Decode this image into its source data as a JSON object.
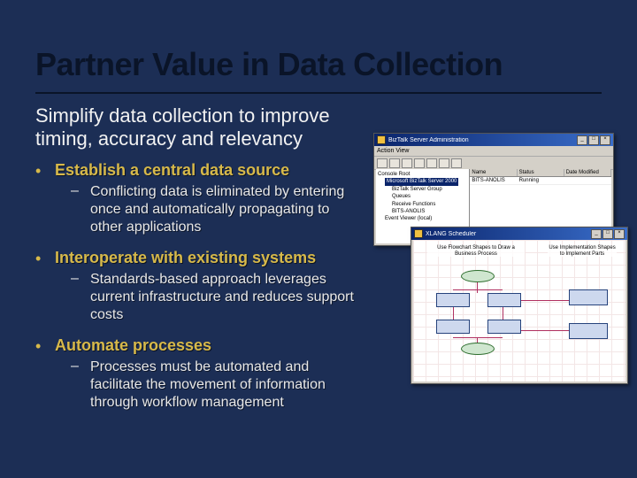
{
  "title": "Partner Value in Data Collection",
  "subtitle": "Simplify data collection to improve timing, accuracy and relevancy",
  "bullets": [
    {
      "heading": "Establish a central data source",
      "subs": [
        "Conflicting data is eliminated by entering once and automatically propagating to other applications"
      ]
    },
    {
      "heading": "Interoperate with existing systems",
      "subs": [
        "Standards-based approach leverages current infrastructure and reduces support costs"
      ]
    },
    {
      "heading": "Automate processes",
      "subs": [
        "Processes must be automated and facilitate the movement of information through workflow management"
      ]
    }
  ],
  "win1": {
    "title": "BizTalk Server Administration",
    "menu": "Action  View",
    "tree": {
      "root": "Console Root",
      "server": "Microsoft BizTalk Server 2000",
      "group": "BizTalk Server Group",
      "n1": "Queues",
      "n2": "Receive Functions",
      "n3": "BITS-ANOLIS",
      "leaf": "Event Viewer (local)"
    },
    "cols": {
      "c1": "Name",
      "c2": "Status",
      "c3": "Date Modified"
    },
    "row": {
      "c1": "BITS-ANOLIS",
      "c2": "Running",
      "c3": ""
    }
  },
  "win2": {
    "title": "XLANG Scheduler",
    "label_left": "Use Flowchart Shapes to Draw a Business Process",
    "label_right": "Use Implementation Shapes to Implement Parts"
  }
}
